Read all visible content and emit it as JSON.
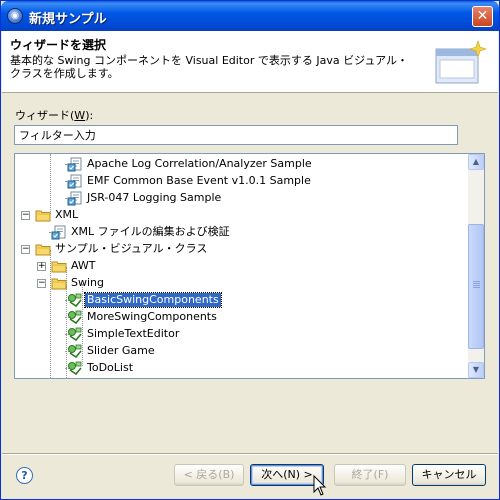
{
  "window": {
    "title": "新規サンプル",
    "app_icon": "eclipse-icon"
  },
  "header": {
    "title": "ウィザードを選択",
    "description": "基本的な Swing コンポーネントを Visual Editor で表示する Java ビジュアル・クラスを作成します。"
  },
  "wizard": {
    "label": "ウィザード(",
    "label_mnemonic": "W",
    "label_suffix": "):",
    "filter_value": "フィルター入力"
  },
  "tree": {
    "items": [
      {
        "label": "Apache Log Correlation/Analyzer Sample",
        "icon": "sample-icon"
      },
      {
        "label": "EMF Common Base Event v1.0.1 Sample",
        "icon": "sample-icon"
      },
      {
        "label": "JSR-047 Logging Sample",
        "icon": "sample-icon"
      },
      {
        "label": "XML",
        "icon": "folder-icon",
        "expanded": true
      },
      {
        "label": "XML ファイルの編集および検証",
        "icon": "sample-icon"
      },
      {
        "label": "サンプル・ビジュアル・クラス",
        "icon": "folder-icon",
        "expanded": true
      },
      {
        "label": "AWT",
        "icon": "folder-icon",
        "expanded": false
      },
      {
        "label": "Swing",
        "icon": "folder-icon",
        "expanded": true
      },
      {
        "label": "BasicSwingComponents",
        "icon": "visual-class-icon",
        "selected": true
      },
      {
        "label": "MoreSwingComponents",
        "icon": "visual-class-icon"
      },
      {
        "label": "SimpleTextEditor",
        "icon": "visual-class-icon"
      },
      {
        "label": "Slider Game",
        "icon": "visual-class-icon"
      },
      {
        "label": "ToDoList",
        "icon": "visual-class-icon"
      }
    ]
  },
  "buttons": {
    "back": "< 戻る(B)",
    "next": "次へ(N) >",
    "finish": "終了(F)",
    "cancel": "キャンセル"
  },
  "colors": {
    "titlebar": "#0058e6",
    "selection": "#316ac5",
    "dialog_bg": "#ece9d8"
  }
}
